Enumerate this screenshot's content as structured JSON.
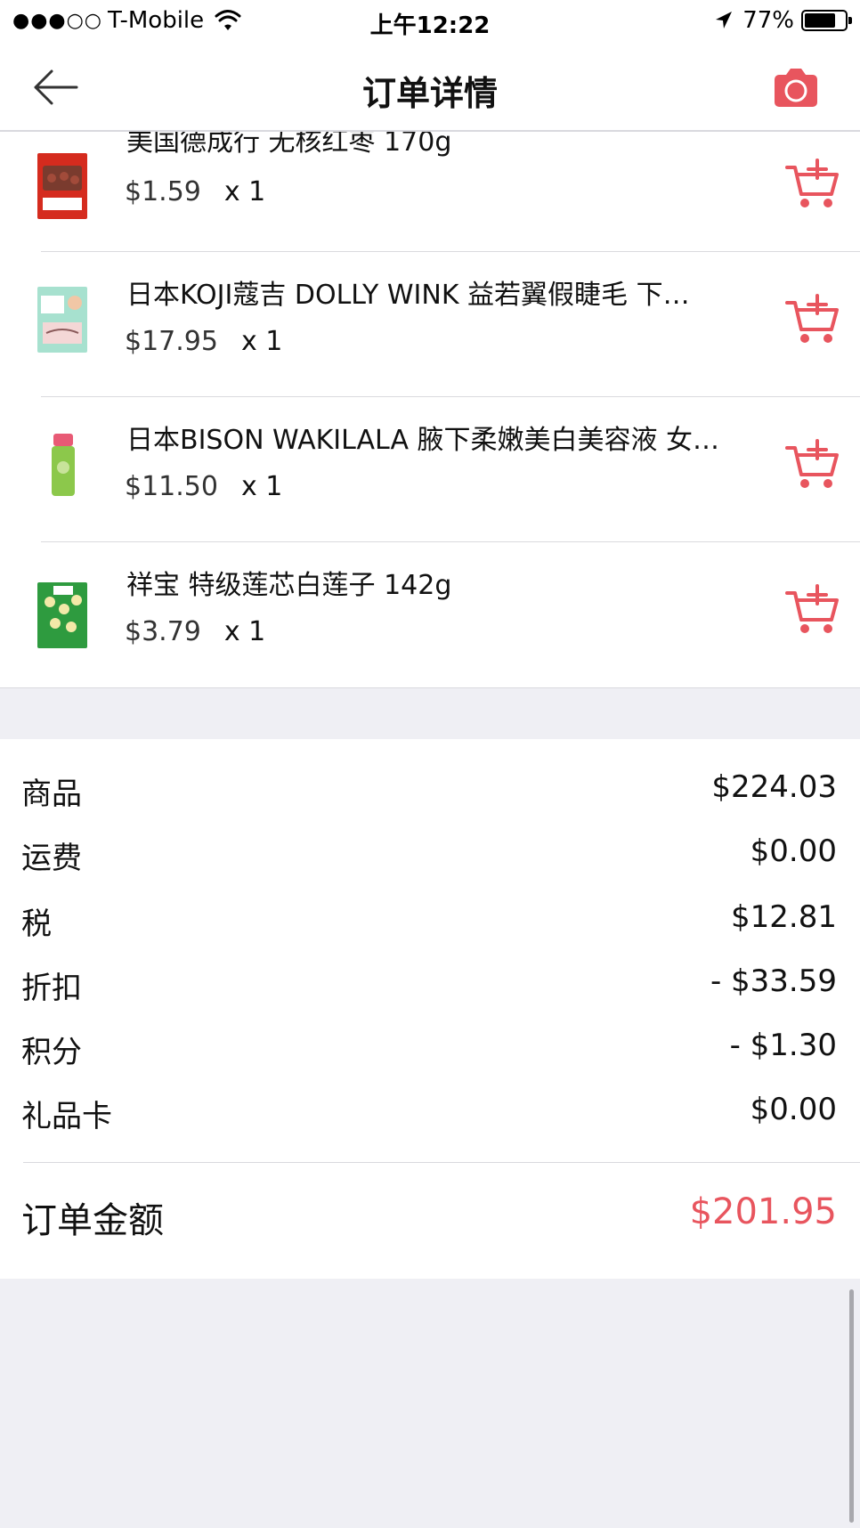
{
  "status_bar": {
    "signal": "●●●○○",
    "carrier": "T-Mobile",
    "time": "上午12:22",
    "battery_pct": "77%",
    "battery_level": 0.77
  },
  "nav": {
    "title": "订单详情",
    "back_icon": "back-arrow-icon",
    "camera_icon": "camera-icon"
  },
  "accent_color": "#e8555e",
  "products": [
    {
      "name": "美国德成行 无核红枣 170g",
      "price": "$1.59",
      "qty": "x 1",
      "thumb_colors": [
        "#d52b1e",
        "#7a3b2e"
      ]
    },
    {
      "name": "日本KOJI蔻吉 DOLLY WINK 益若翼假睫毛 下…",
      "price": "$17.95",
      "qty": "x 1",
      "thumb_colors": [
        "#a7e1cf",
        "#f4d7d6"
      ]
    },
    {
      "name": "日本BISON WAKILALA 腋下柔嫩美白美容液 女…",
      "price": "$11.50",
      "qty": "x 1",
      "thumb_colors": [
        "#8cc84b",
        "#e85a75"
      ]
    },
    {
      "name": "祥宝 特级莲芯白莲子 142g",
      "price": "$3.79",
      "qty": "x 1",
      "thumb_colors": [
        "#2e9b3f",
        "#f3e9a8"
      ]
    }
  ],
  "cart_icon": "add-to-cart-icon",
  "summary": {
    "rows": [
      {
        "label": "商品",
        "value": "$224.03"
      },
      {
        "label": "运费",
        "value": "$0.00"
      },
      {
        "label": "税",
        "value": "$12.81"
      },
      {
        "label": "折扣",
        "value": "- $33.59"
      },
      {
        "label": "积分",
        "value": "- $1.30"
      },
      {
        "label": "礼品卡",
        "value": "$0.00"
      }
    ],
    "total_label": "订单金额",
    "total_value": "$201.95"
  }
}
